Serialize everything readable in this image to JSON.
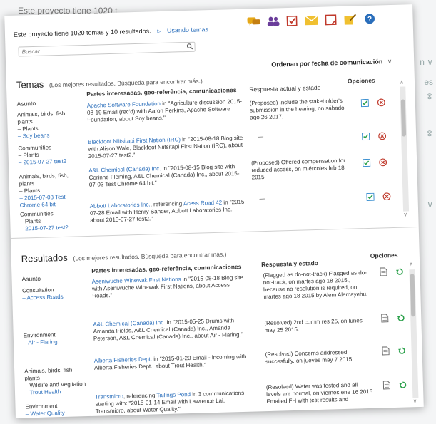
{
  "background": {
    "top_hint": "Este proyecto tiene 1020 t",
    "right_items": [
      "n ∨",
      "es",
      "⊗",
      "⊗",
      "∨"
    ]
  },
  "summary": {
    "text": "Este proyecto tiene 1020 temas y 10 resultados.",
    "link": "Usando temas"
  },
  "toolbar": {
    "icons": [
      "comments-icon",
      "people-icon",
      "checklist-icon",
      "email-icon",
      "document-icon",
      "note-icon",
      "help-icon"
    ],
    "colors": {
      "comments": "#e6a817",
      "people": "#6a3d9a",
      "checklist": "#c0392b",
      "email": "#f0c030",
      "document": "#c0392b",
      "note": "#f0c030",
      "help": "#2a6ebb"
    }
  },
  "search": {
    "placeholder": "Buscar"
  },
  "sort": {
    "label": "Ordenan por fecha de comunicación"
  },
  "temas": {
    "title": "Temas",
    "subtitle": "(Los mejores resultados. Búsqueda para encontrar más.)",
    "headers": {
      "subject": "Asunto",
      "parties": "Partes interesadas, geo-referência, comunicaciones",
      "response": "Respuesta actual y estado",
      "options": "Opciones"
    },
    "rows": [
      {
        "subject": [
          "Animals, birds, fish, plants",
          "– Plants",
          "– Soy beans"
        ],
        "parties": [
          "Apache Software Foundation",
          " in \"Agriculture discussion 2015-08-19 Email (rec'd) with Aaron Perkins, Apache Software Foundation, about Soy beans.\""
        ],
        "response": "(Proposed) Include the stakeholder's submission in the hearing, on sábado ago 26 2017."
      },
      {
        "subject": [
          "Communities",
          "– Plants",
          "– 2015-07-27 test2"
        ],
        "parties": [
          "Blackfoot Niitsitapi First Nation (IRC)",
          " in \"2015-08-18 Blog site with Alison Wale, Blackfoot Niitsitapi First Nation (IRC), about 2015-07-27 test2.\""
        ],
        "response": "—"
      },
      {
        "subject": [
          "Animals, birds, fish, plants",
          "– Plants",
          "– 2015-07-03 Test Chrome 64 bit"
        ],
        "parties": [
          "A&L Chemical (Canada) Inc.",
          " in \"2015-08-15 Blog site with Corinne Fleming, A&L Chemical (Canada) Inc., about 2015-07-03 Test Chrome 64 bit.\""
        ],
        "response": "(Proposed) Offered compensation for reduced access, on miércoles feb 18 2015."
      },
      {
        "subject": [
          "Communities",
          "– Plants",
          "– 2015-07-27 test2"
        ],
        "parties": [
          "Abbott Laboratories Inc.",
          ", referencing ",
          "Acess Road 42",
          " in \"2015-07-28 Email with Henry Sander, Abbott Laboratories Inc., about 2015-07-27 test2.\""
        ],
        "response": "—"
      }
    ]
  },
  "resultados": {
    "title": "Resultados",
    "subtitle": "(Los mejores resultados. Búsqueda para encontrar más.)",
    "headers": {
      "subject": "Asunto",
      "parties": "Partes interesadas, geo-referência, comunicaciones",
      "response": "Respuesta y estado",
      "options": "Opciones"
    },
    "rows": [
      {
        "subject": [
          "Consultation",
          "– Access Roads"
        ],
        "parties": [
          "Aseniwuche Winewak First Nations",
          " in \"2015-08-18 Blog site with Aseniwuche Winewak First Nations, about Access Roads.\""
        ],
        "response": "(Flagged as do-not-track) Flagged as do-not-track, on martes ago 18 2015., because no resolution is required, on martes ago 18 2015 by Alem Alemayehu."
      },
      {
        "subject": [
          "Environment",
          "– Air - Flaring"
        ],
        "parties": [
          "A&L Chemical (Canada) Inc.",
          " in \"2015-05-25 Drums with Amanda Fields, A&L Chemical (Canada) Inc., Amanda Peterson, A&L Chemical (Canada) Inc., about Air - Flaring.\""
        ],
        "response": "(Resolved) 2nd comm res 25, on lunes may 25 2015."
      },
      {
        "subject": [
          "Animals, birds, fish, plants",
          "– Wildlife and Vegitation",
          "– Trout Health"
        ],
        "parties": [
          "Alberta Fisheries Dept.",
          " in \"2015-01-20 Email - incoming with Alberta Fisheries Dept., about Trout Health.\""
        ],
        "response": "(Resolved) Concerns addressed succesfully, on jueves may 7 2015."
      },
      {
        "subject": [
          "Environment",
          "– Water Quality"
        ],
        "parties": [
          "Transmicro",
          ", referencing ",
          "Tailings Pond",
          " in 3 communications starting with: \"2015-01-14 Email with Lawrence Lai, Transmicro, about Water Quality.\""
        ],
        "response": "(Resolved) Water was tested and all levels are normal, on viernes ene 16 2015 Emailed FH with test results and"
      }
    ]
  }
}
